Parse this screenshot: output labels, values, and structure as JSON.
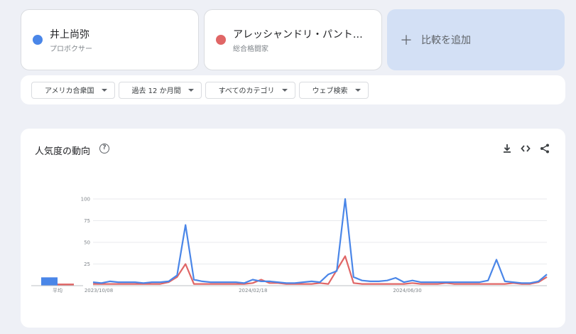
{
  "terms": [
    {
      "name": "井上尚弥",
      "subtitle": "プロボクサー",
      "color": "#4a86e8"
    },
    {
      "name": "アレッシャンドリ・パント…",
      "subtitle": "総合格闘家",
      "color": "#e06666"
    }
  ],
  "add_compare": {
    "label": "比較を追加",
    "icon": "plus-icon"
  },
  "filters": [
    "アメリカ合衆国",
    "過去 12 か月間",
    "すべてのカテゴリ",
    "ウェブ検索"
  ],
  "section": {
    "title": "人気度の動向",
    "help_icon": "?",
    "actions": [
      "download-icon",
      "embed-icon",
      "share-icon"
    ]
  },
  "chart_data": {
    "type": "line",
    "x_tick_labels": [
      "2023/10/08",
      "2024/02/18",
      "2024/06/30"
    ],
    "y_tick_labels": [
      "100",
      "75",
      "50",
      "25"
    ],
    "ylim": [
      0,
      100
    ],
    "average_label": "平均",
    "averages": [
      8,
      2
    ],
    "series": [
      {
        "name": "井上尚弥",
        "color": "#4a86e8",
        "values": [
          4,
          3,
          5,
          4,
          4,
          4,
          3,
          4,
          4,
          5,
          12,
          70,
          7,
          5,
          4,
          4,
          4,
          4,
          3,
          7,
          5,
          5,
          4,
          3,
          3,
          4,
          5,
          4,
          13,
          17,
          100,
          10,
          6,
          5,
          5,
          6,
          9,
          4,
          6,
          4,
          4,
          4,
          4,
          4,
          4,
          4,
          4,
          6,
          30,
          5,
          4,
          3,
          3,
          5,
          13
        ]
      },
      {
        "name": "アレッシャンドリ・パントージャ",
        "color": "#e06666",
        "values": [
          2,
          2,
          2,
          2,
          2,
          2,
          2,
          2,
          2,
          4,
          10,
          25,
          2,
          2,
          2,
          2,
          2,
          2,
          2,
          3,
          7,
          3,
          3,
          2,
          2,
          2,
          2,
          3,
          2,
          18,
          34,
          3,
          2,
          2,
          2,
          2,
          2,
          2,
          3,
          2,
          2,
          2,
          3,
          2,
          2,
          2,
          2,
          2,
          2,
          2,
          3,
          2,
          2,
          4,
          10
        ]
      }
    ]
  }
}
